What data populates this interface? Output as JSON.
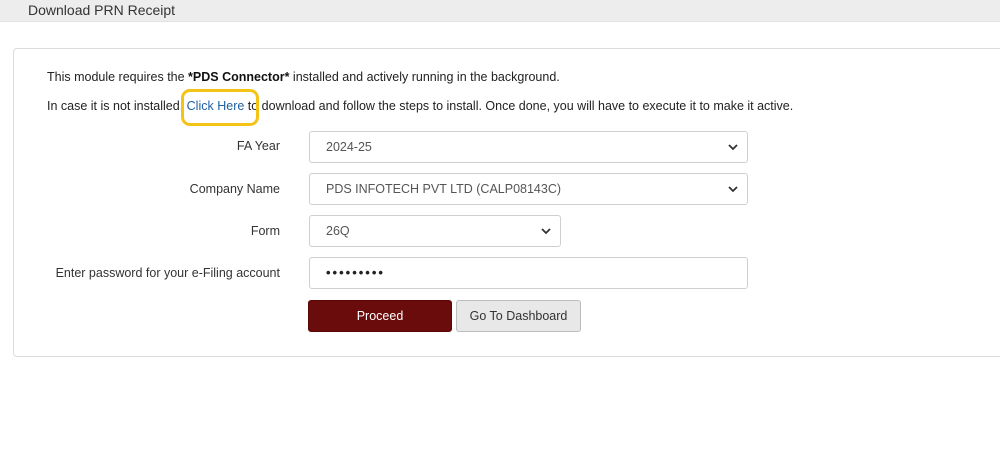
{
  "header": {
    "title": "Download PRN Receipt"
  },
  "notice": {
    "line1_prefix": "This module requires the ",
    "line1_bold": "*PDS Connector*",
    "line1_suffix": " installed and actively running in the background.",
    "line2_prefix": "In case it is not installed, ",
    "line2_link": "Click Here",
    "line2_suffix": " to download and follow the steps to install. Once done, you will have to execute it to make it active."
  },
  "form": {
    "fa_year": {
      "label": "FA Year",
      "value": "2024-25"
    },
    "company": {
      "label": "Company Name",
      "value": "PDS INFOTECH PVT LTD (CALP08143C)"
    },
    "form_type": {
      "label": "Form",
      "value": "26Q"
    },
    "password": {
      "label": "Enter password for your e-Filing account",
      "value": "•••••••••"
    }
  },
  "buttons": {
    "proceed": "Proceed",
    "dashboard": "Go To Dashboard"
  },
  "colors": {
    "primary_button": "#6b0c0c",
    "link": "#1f5fa3",
    "highlight": "#f3c315"
  }
}
